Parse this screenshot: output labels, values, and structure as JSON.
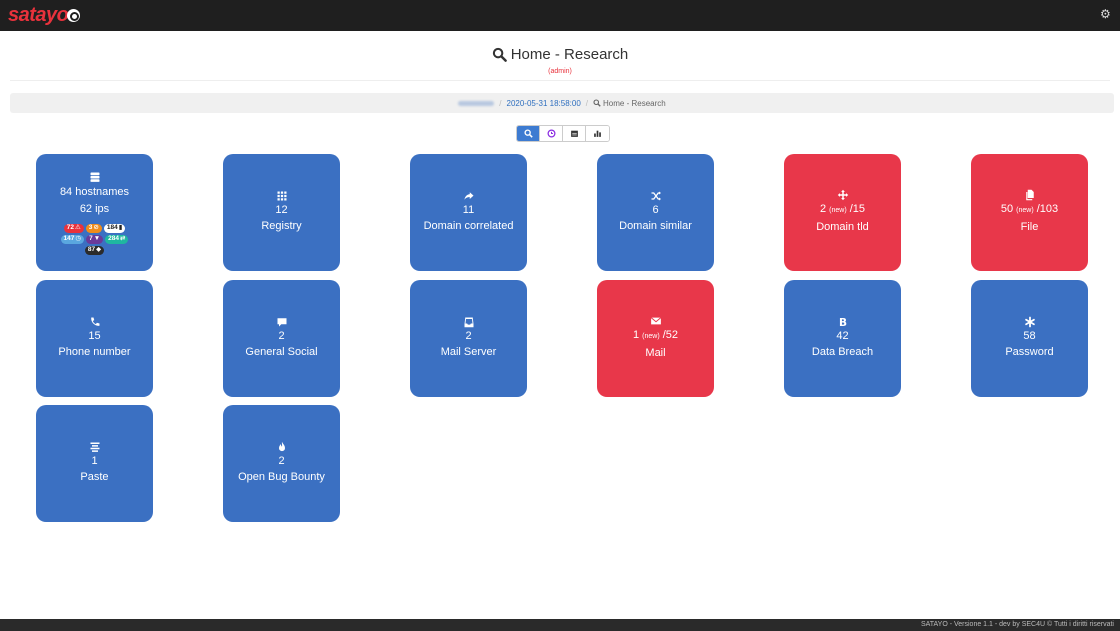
{
  "app": {
    "logo": "satayo"
  },
  "header": {
    "title": "Home - Research",
    "role": "(admin)"
  },
  "breadcrumb": {
    "date": "2020-05-31 18:58:00",
    "current": "Home - Research"
  },
  "hostnames_tile": {
    "hostnames": "84 hostnames",
    "ips": "62 ips",
    "badges": [
      "72",
      "3",
      "184",
      "147",
      "7",
      "284",
      "87"
    ]
  },
  "tiles": [
    {
      "count": "12",
      "label": "Registry"
    },
    {
      "count": "11",
      "label": "Domain correlated"
    },
    {
      "count": "6",
      "label": "Domain similar"
    },
    {
      "count": "2",
      "new": "(new)",
      "total": "/15",
      "label": "Domain tld"
    },
    {
      "count": "50",
      "new": "(new)",
      "total": "/103",
      "label": "File"
    },
    {
      "count": "15",
      "label": "Phone number"
    },
    {
      "count": "2",
      "label": "General Social"
    },
    {
      "count": "2",
      "label": "Mail Server"
    },
    {
      "count": "1",
      "new": "(new)",
      "total": "/52",
      "label": "Mail"
    },
    {
      "count": "42",
      "label": "Data Breach"
    },
    {
      "count": "58",
      "label": "Password"
    },
    {
      "count": "1",
      "label": "Paste"
    },
    {
      "count": "2",
      "label": "Open Bug Bounty"
    }
  ],
  "footer": {
    "text": "SATAYO - Versione 1.1 - dev by SEC4U © Tutti i diritti riservati"
  },
  "colors": {
    "tile_blue": "#3b70c2",
    "tile_red": "#e8374a",
    "logo_red": "#e8323c"
  }
}
